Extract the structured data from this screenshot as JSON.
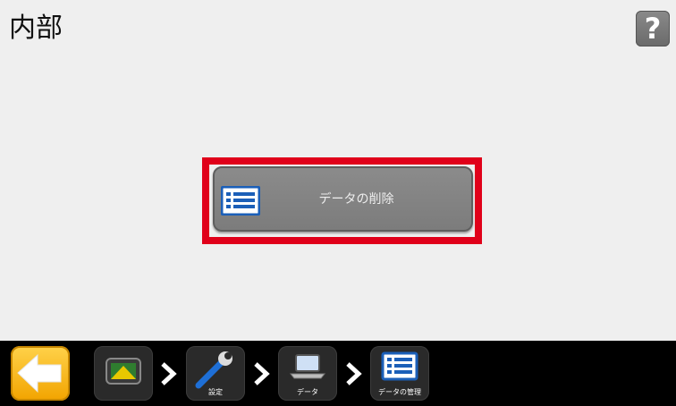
{
  "header": {
    "title": "内部",
    "help_label": "?"
  },
  "main": {
    "action_button_label": "データの削除"
  },
  "breadcrumbs": [
    {
      "label": ""
    },
    {
      "label": "設定"
    },
    {
      "label": "データ"
    },
    {
      "label": "データの管理"
    }
  ],
  "colors": {
    "highlight": "#e0001a",
    "back_button": "#f2a400",
    "footer": "#000000"
  },
  "icons": {
    "back": "arrow-left-icon",
    "home": "display-device-icon",
    "settings": "wrench-icon",
    "data": "laptop-icon",
    "data_management": "list-icon"
  }
}
